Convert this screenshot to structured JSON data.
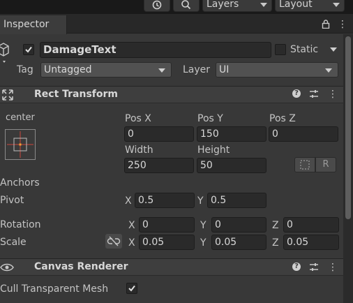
{
  "toolbar": {
    "layers_label": "Layers",
    "layout_label": "Layout"
  },
  "tabs": {
    "inspector_label": "Inspector"
  },
  "object": {
    "name": "DamageText",
    "active": true,
    "static_label": "Static",
    "static_checked": false,
    "tag_label": "Tag",
    "tag_value": "Untagged",
    "layer_label": "Layer",
    "layer_value": "UI"
  },
  "rect_transform": {
    "title": "Rect Transform",
    "anchor_preset_label": "center",
    "pos_x_label": "Pos X",
    "pos_y_label": "Pos Y",
    "pos_z_label": "Pos Z",
    "pos_x": "0",
    "pos_y": "150",
    "pos_z": "0",
    "width_label": "Width",
    "height_label": "Height",
    "width": "250",
    "height": "50",
    "anchors_label": "Anchors",
    "pivot_label": "Pivot",
    "pivot_x": "0.5",
    "pivot_y": "0.5",
    "rotation_label": "Rotation",
    "rotation_x": "0",
    "rotation_y": "0",
    "rotation_z": "0",
    "scale_label": "Scale",
    "scale_x": "0.05",
    "scale_y": "0.05",
    "scale_z": "0.05",
    "x_label": "X",
    "y_label": "Y",
    "z_label": "Z",
    "raw_edit_label": "R"
  },
  "canvas_renderer": {
    "title": "Canvas Renderer",
    "cull_label": "Cull Transparent Mesh",
    "cull_checked": true
  },
  "colors": {
    "anchor_red": "#c9453c",
    "anchor_orange": "#f0a030"
  }
}
